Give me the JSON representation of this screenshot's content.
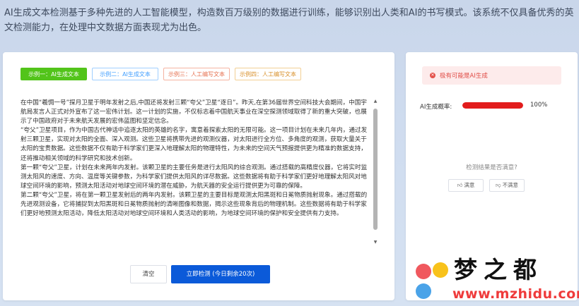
{
  "intro": "AI生成文本检测基于多种先进的人工智能模型，构造数百万级别的数据进行训练，能够识别出人类和AI的书写模式。该系统不仅具备优秀的英文检测能力，在处理中文数据方面表现尤为出色。",
  "examples": [
    {
      "label": "示例一：AI生成文本"
    },
    {
      "label": "示例二：AI生成文本"
    },
    {
      "label": "示例三：人工编写文本"
    },
    {
      "label": "示例四：人工编写文本"
    }
  ],
  "input_paragraphs": [
    "在中国“羲惆一号”探月卫星于明年发射之后,中国还将发射三颗“夸父”卫星“逐日”。昨天,在第36届世界空间科技大会期间，中国宇航局发言人正式对外宣布了这一宏伟计划。这一计划的实施，不仅标志着中国航天事业在深空探测领域取得了新的重大突破，也展示了中国政府对于未来航天发展的宏伟蓝图和坚定信念。",
    "“夸父”卫星项目，作为中国古代神话中追逐太阳的英雄的名字，寓意着探索太阳的无限可能。这一项目计划在未来几年内，通过发射三颗卫星，实现对太阳的全面、深入观测。这些卫星将携带先进的观测仪器，对太阳进行全方位、多角度的观测，获取大量关于太阳的宝贵数据。这些数据不仅有助于科学家们更深入地理解太阳的物理特性，为未来的空间天气预报提供更为精准的数据支持，还将推动相关领域的科学研究和技术创新。",
    "第一颗“夸父”卫星，计划在未来两年内发射。该颗卫星的主要任务是进行太阳风的综合观测。通过搭载的高精度仪器，它将实时监测太阳风的速度、方向、温度等关键参数，为科学家们提供太阳风的详尽数据。这些数据将有助于科学家们更好地理解太阳风对地球空间环境的影响，预测太阳活动对地球空间环境的潜在威胁，为航天器的安全运行提供更为可靠的保障。",
    "第二颗“夸父”卫星，将在第一颗卫星发射后的两年内发射。该颗卫星的主要目标是观测太阳黑斑和日冕物质抛射现象。通过搭载的先进观测设备，它将捕捉到太阳黑斑和日冕物质抛射的清晰图像和数据，揭示这些现象背后的物理机制。这些数据将有助于科学家们更好地预测太阳活动，降低太阳活动对地球空间环境和人类活动的影响，为地球空间环境的保护和安全提供有力支持。"
  ],
  "buttons": {
    "clear": "清空",
    "detect": "立即检测 (今日剩余20次)"
  },
  "result": {
    "alert": "极有可能是AI生成",
    "prob_label": "AI生成概率:",
    "prob_value": "100%",
    "prob_fraction": 1.0,
    "feedback_question": "检测结果是否满意?",
    "satisfied": "满意",
    "unsatisfied": "不满意"
  },
  "watermark": {
    "brand": "梦之都",
    "url": "www.mzhidu.com"
  },
  "colors": {
    "accent_blue": "#0b5ad9",
    "danger_red": "#e21c1c",
    "example_green": "#52c41a"
  }
}
